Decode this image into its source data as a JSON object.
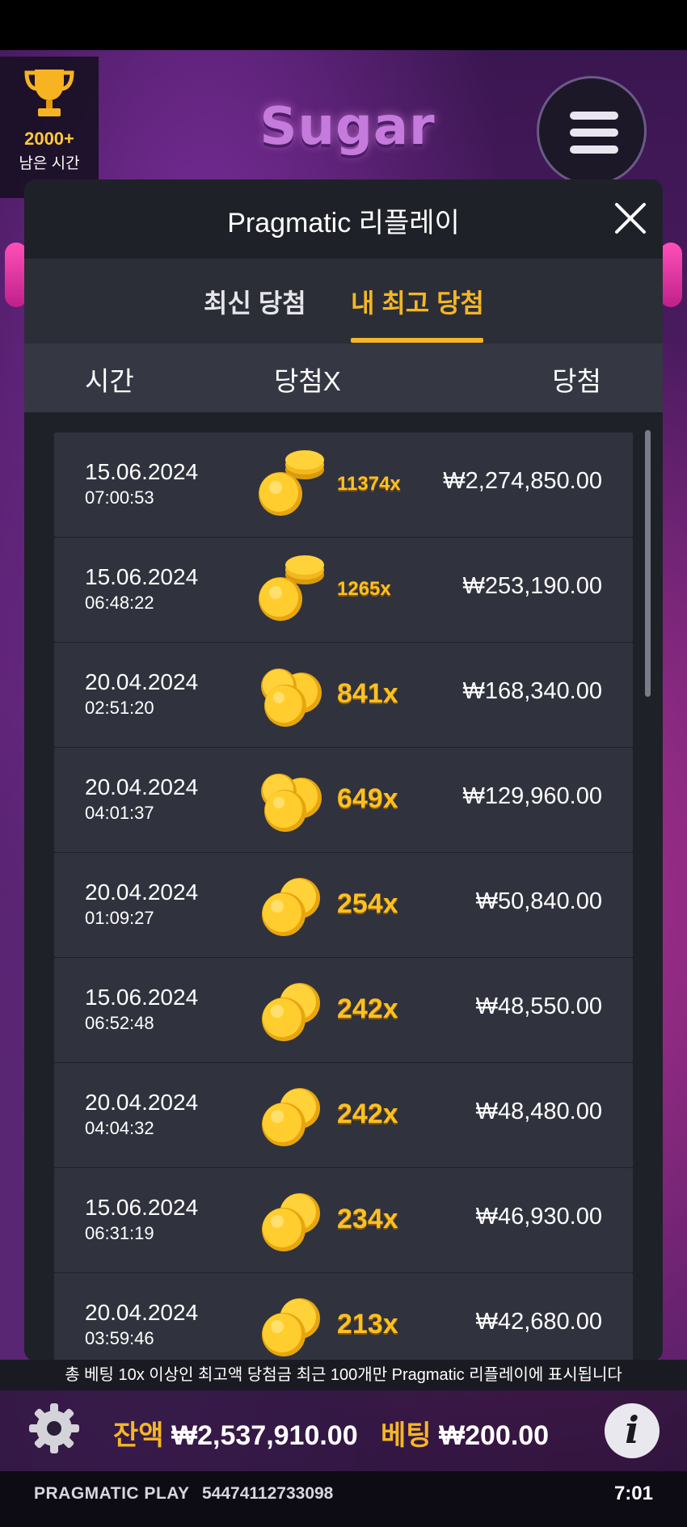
{
  "game": {
    "logo_text": "Sugar"
  },
  "tournament": {
    "count": "2000+",
    "time_label": "남은 시간"
  },
  "modal": {
    "title": "Pragmatic 리플레이",
    "tabs": [
      {
        "label": "최신 당첨",
        "active": false
      },
      {
        "label": "내 최고 당첨",
        "active": true
      }
    ],
    "columns": {
      "time": "시간",
      "multiplier": "당첨X",
      "win": "당첨"
    },
    "rows": [
      {
        "date": "15.06.2024",
        "time": "07:00:53",
        "multiplier": "11374x",
        "win": "₩2,274,850.00",
        "icon": "coin-stack-icon"
      },
      {
        "date": "15.06.2024",
        "time": "06:48:22",
        "multiplier": "1265x",
        "win": "₩253,190.00",
        "icon": "coin-stack-icon"
      },
      {
        "date": "20.04.2024",
        "time": "02:51:20",
        "multiplier": "841x",
        "win": "₩168,340.00",
        "icon": "coin-pile-icon"
      },
      {
        "date": "20.04.2024",
        "time": "04:01:37",
        "multiplier": "649x",
        "win": "₩129,960.00",
        "icon": "coin-pile-icon"
      },
      {
        "date": "20.04.2024",
        "time": "01:09:27",
        "multiplier": "254x",
        "win": "₩50,840.00",
        "icon": "coins-icon"
      },
      {
        "date": "15.06.2024",
        "time": "06:52:48",
        "multiplier": "242x",
        "win": "₩48,550.00",
        "icon": "coins-icon"
      },
      {
        "date": "20.04.2024",
        "time": "04:04:32",
        "multiplier": "242x",
        "win": "₩48,480.00",
        "icon": "coins-icon"
      },
      {
        "date": "15.06.2024",
        "time": "06:31:19",
        "multiplier": "234x",
        "win": "₩46,930.00",
        "icon": "coins-icon"
      },
      {
        "date": "20.04.2024",
        "time": "03:59:46",
        "multiplier": "213x",
        "win": "₩42,680.00",
        "icon": "coins-icon"
      }
    ]
  },
  "footer_note": "총 베팅 10x 이상인 최고액 당첨금 최근 100개만 Pragmatic 리플레이에 표시됩니다",
  "balance": {
    "label": "잔액",
    "value": "₩2,537,910.00"
  },
  "bet": {
    "label": "베팅",
    "value": "₩200.00"
  },
  "status": {
    "brand": "PRAGMATIC PLAY",
    "session_id": "54474112733098",
    "clock": "7:01"
  },
  "colors": {
    "accent": "#f5b625",
    "modal_bg": "#1f2128",
    "row_bg": "#30333d"
  }
}
